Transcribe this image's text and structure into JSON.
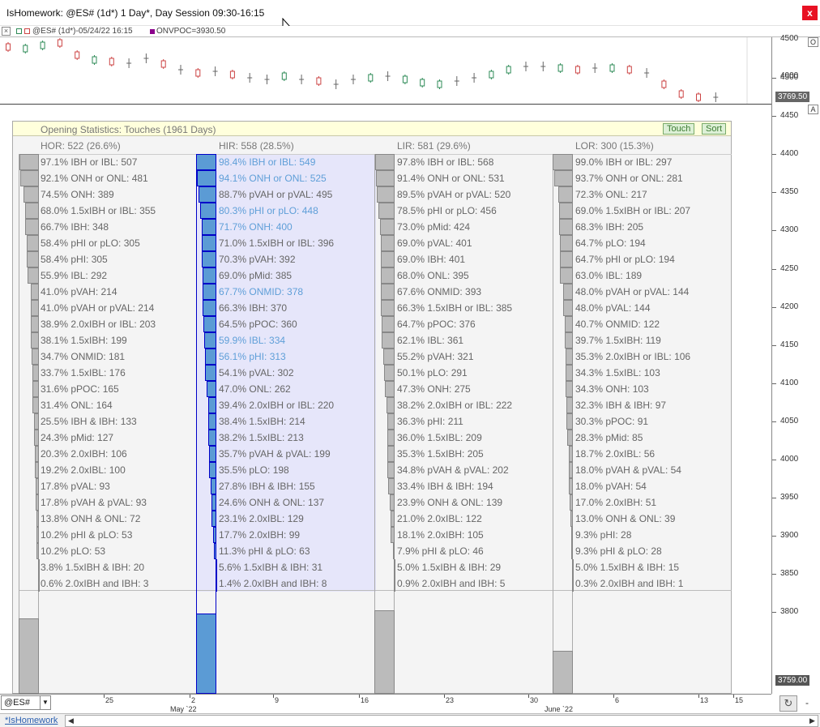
{
  "window": {
    "title": "IsHomework: @ES# (1d*) 1 Day*, Day Session 09:30-16:15",
    "close_label": "x"
  },
  "infobar": {
    "symbol_label": "@ES# (1d*)-05/24/22 16:15",
    "onvpoc_label": "ONVPOC=3930.50"
  },
  "price_axis": {
    "ticks": [
      "4500",
      "4450",
      "4400",
      "4350",
      "4300",
      "4250",
      "4200",
      "4150",
      "4100",
      "4050",
      "4000",
      "3950",
      "3900",
      "3850",
      "3800"
    ],
    "upper_ticks": [
      "4500",
      "4000"
    ],
    "last_price_upper": "3769.50",
    "last_price_lower": "3759.00",
    "btn_o": "O",
    "btn_a": "A"
  },
  "stats": {
    "title": "Opening Statistics: Touches (1961 Days)",
    "touch_label": "Touch",
    "sort_label": "Sort",
    "columns": [
      {
        "header": "HOR: 522 (26.6%)",
        "bottom_fraction": 0.266,
        "rows": [
          {
            "pct": 97.1,
            "text": "97.1%  IBH or IBL: 507"
          },
          {
            "pct": 92.1,
            "text": "92.1%  ONH or ONL: 481"
          },
          {
            "pct": 74.5,
            "text": "74.5%  ONH: 389"
          },
          {
            "pct": 68.0,
            "text": "68.0%  1.5xIBH or IBL: 355"
          },
          {
            "pct": 66.7,
            "text": "66.7%  IBH: 348"
          },
          {
            "pct": 58.4,
            "text": "58.4%  pHI or pLO: 305"
          },
          {
            "pct": 58.4,
            "text": "58.4%  pHI: 305"
          },
          {
            "pct": 55.9,
            "text": "55.9%  IBL: 292"
          },
          {
            "pct": 41.0,
            "text": "41.0%  pVAH: 214"
          },
          {
            "pct": 41.0,
            "text": "41.0%  pVAH or pVAL: 214"
          },
          {
            "pct": 38.9,
            "text": "38.9%  2.0xIBH or IBL: 203"
          },
          {
            "pct": 38.1,
            "text": "38.1%  1.5xIBH: 199"
          },
          {
            "pct": 34.7,
            "text": "34.7%  ONMID: 181"
          },
          {
            "pct": 33.7,
            "text": "33.7%  1.5xIBL: 176"
          },
          {
            "pct": 31.6,
            "text": "31.6%  pPOC: 165"
          },
          {
            "pct": 31.4,
            "text": "31.4%  ONL: 164"
          },
          {
            "pct": 25.5,
            "text": "25.5%  IBH & IBH: 133"
          },
          {
            "pct": 24.3,
            "text": "24.3%  pMid: 127"
          },
          {
            "pct": 20.3,
            "text": "20.3%  2.0xIBH: 106"
          },
          {
            "pct": 19.2,
            "text": "19.2%  2.0xIBL: 100"
          },
          {
            "pct": 17.8,
            "text": "17.8%  pVAL: 93"
          },
          {
            "pct": 17.8,
            "text": "17.8%  pVAH & pVAL: 93"
          },
          {
            "pct": 13.8,
            "text": "13.8%  ONH & ONL: 72"
          },
          {
            "pct": 10.2,
            "text": "10.2%  pHI & pLO: 53"
          },
          {
            "pct": 10.2,
            "text": "10.2%  pLO: 53"
          },
          {
            "pct": 3.8,
            "text": "3.8%  1.5xIBH & IBH: 20"
          },
          {
            "pct": 0.6,
            "text": "0.6%  2.0xIBH and IBH: 3"
          }
        ]
      },
      {
        "header": "HIR: 558 (28.5%)",
        "bottom_fraction": 0.285,
        "rows": [
          {
            "pct": 98.4,
            "text": "98.4%  IBH or IBL: 549",
            "hl": true
          },
          {
            "pct": 94.1,
            "text": "94.1%  ONH or ONL: 525",
            "hl": true
          },
          {
            "pct": 88.7,
            "text": "88.7%  pVAH or pVAL: 495"
          },
          {
            "pct": 80.3,
            "text": "80.3%  pHI or pLO: 448",
            "hl": true
          },
          {
            "pct": 71.7,
            "text": "71.7%  ONH: 400",
            "hl": true
          },
          {
            "pct": 71.0,
            "text": "71.0%  1.5xIBH or IBL: 396"
          },
          {
            "pct": 70.3,
            "text": "70.3%  pVAH: 392"
          },
          {
            "pct": 69.0,
            "text": "69.0%  pMid: 385"
          },
          {
            "pct": 67.7,
            "text": "67.7%  ONMID: 378",
            "hl": true
          },
          {
            "pct": 66.3,
            "text": "66.3%  IBH: 370"
          },
          {
            "pct": 64.5,
            "text": "64.5%  pPOC: 360"
          },
          {
            "pct": 59.9,
            "text": "59.9%  IBL: 334",
            "hl": true
          },
          {
            "pct": 56.1,
            "text": "56.1%  pHI: 313",
            "hl": true
          },
          {
            "pct": 54.1,
            "text": "54.1%  pVAL: 302"
          },
          {
            "pct": 47.0,
            "text": "47.0%  ONL: 262"
          },
          {
            "pct": 39.4,
            "text": "39.4%  2.0xIBH or IBL: 220"
          },
          {
            "pct": 38.4,
            "text": "38.4%  1.5xIBH: 214"
          },
          {
            "pct": 38.2,
            "text": "38.2%  1.5xIBL: 213"
          },
          {
            "pct": 35.7,
            "text": "35.7%  pVAH & pVAL: 199"
          },
          {
            "pct": 35.5,
            "text": "35.5%  pLO: 198"
          },
          {
            "pct": 27.8,
            "text": "27.8%  IBH & IBH: 155"
          },
          {
            "pct": 24.6,
            "text": "24.6%  ONH & ONL: 137"
          },
          {
            "pct": 23.1,
            "text": "23.1%  2.0xIBL: 129"
          },
          {
            "pct": 17.7,
            "text": "17.7%  2.0xIBH: 99"
          },
          {
            "pct": 11.3,
            "text": "11.3%  pHI & pLO: 63"
          },
          {
            "pct": 5.6,
            "text": "5.6%  1.5xIBH & IBH: 31"
          },
          {
            "pct": 1.4,
            "text": "1.4%  2.0xIBH and IBH: 8"
          }
        ]
      },
      {
        "header": "LIR: 581 (29.6%)",
        "bottom_fraction": 0.296,
        "rows": [
          {
            "pct": 97.8,
            "text": "97.8%  IBH or IBL: 568"
          },
          {
            "pct": 91.4,
            "text": "91.4%  ONH or ONL: 531"
          },
          {
            "pct": 89.5,
            "text": "89.5%  pVAH or pVAL: 520"
          },
          {
            "pct": 78.5,
            "text": "78.5%  pHI or pLO: 456"
          },
          {
            "pct": 73.0,
            "text": "73.0%  pMid: 424"
          },
          {
            "pct": 69.0,
            "text": "69.0%  pVAL: 401"
          },
          {
            "pct": 69.0,
            "text": "69.0%  IBH: 401"
          },
          {
            "pct": 68.0,
            "text": "68.0%  ONL: 395"
          },
          {
            "pct": 67.6,
            "text": "67.6%  ONMID: 393"
          },
          {
            "pct": 66.3,
            "text": "66.3%  1.5xIBH or IBL: 385"
          },
          {
            "pct": 64.7,
            "text": "64.7%  pPOC: 376"
          },
          {
            "pct": 62.1,
            "text": "62.1%  IBL: 361"
          },
          {
            "pct": 55.2,
            "text": "55.2%  pVAH: 321"
          },
          {
            "pct": 50.1,
            "text": "50.1%  pLO: 291"
          },
          {
            "pct": 47.3,
            "text": "47.3%  ONH: 275"
          },
          {
            "pct": 38.2,
            "text": "38.2%  2.0xIBH or IBL: 222"
          },
          {
            "pct": 36.3,
            "text": "36.3%  pHI: 211"
          },
          {
            "pct": 36.0,
            "text": "36.0%  1.5xIBL: 209"
          },
          {
            "pct": 35.3,
            "text": "35.3%  1.5xIBH: 205"
          },
          {
            "pct": 34.8,
            "text": "34.8%  pVAH & pVAL: 202"
          },
          {
            "pct": 33.4,
            "text": "33.4%  IBH & IBH: 194"
          },
          {
            "pct": 23.9,
            "text": "23.9%  ONH & ONL: 139"
          },
          {
            "pct": 21.0,
            "text": "21.0%  2.0xIBL: 122"
          },
          {
            "pct": 18.1,
            "text": "18.1%  2.0xIBH: 105"
          },
          {
            "pct": 7.9,
            "text": "7.9%  pHI & pLO: 46"
          },
          {
            "pct": 5.0,
            "text": "5.0%  1.5xIBH & IBH: 29"
          },
          {
            "pct": 0.9,
            "text": "0.9%  2.0xIBH and IBH: 5"
          }
        ]
      },
      {
        "header": "LOR: 300 (15.3%)",
        "bottom_fraction": 0.153,
        "rows": [
          {
            "pct": 99.0,
            "text": "99.0%  IBH or IBL: 297"
          },
          {
            "pct": 93.7,
            "text": "93.7%  ONH or ONL: 281"
          },
          {
            "pct": 72.3,
            "text": "72.3%  ONL: 217"
          },
          {
            "pct": 69.0,
            "text": "69.0%  1.5xIBH or IBL: 207"
          },
          {
            "pct": 68.3,
            "text": "68.3%  IBH: 205"
          },
          {
            "pct": 64.7,
            "text": "64.7%  pLO: 194"
          },
          {
            "pct": 64.7,
            "text": "64.7%  pHI or pLO: 194"
          },
          {
            "pct": 63.0,
            "text": "63.0%  IBL: 189"
          },
          {
            "pct": 48.0,
            "text": "48.0%  pVAH or pVAL: 144"
          },
          {
            "pct": 48.0,
            "text": "48.0%  pVAL: 144"
          },
          {
            "pct": 40.7,
            "text": "40.7%  ONMID: 122"
          },
          {
            "pct": 39.7,
            "text": "39.7%  1.5xIBH: 119"
          },
          {
            "pct": 35.3,
            "text": "35.3%  2.0xIBH or IBL: 106"
          },
          {
            "pct": 34.3,
            "text": "34.3%  1.5xIBL: 103"
          },
          {
            "pct": 34.3,
            "text": "34.3%  ONH: 103"
          },
          {
            "pct": 32.3,
            "text": "32.3%  IBH & IBH: 97"
          },
          {
            "pct": 30.3,
            "text": "30.3%  pPOC: 91"
          },
          {
            "pct": 28.3,
            "text": "28.3%  pMid: 85"
          },
          {
            "pct": 18.7,
            "text": "18.7%  2.0xIBL: 56"
          },
          {
            "pct": 18.0,
            "text": "18.0%  pVAH & pVAL: 54"
          },
          {
            "pct": 18.0,
            "text": "18.0%  pVAH: 54"
          },
          {
            "pct": 17.0,
            "text": "17.0%  2.0xIBH: 51"
          },
          {
            "pct": 13.0,
            "text": "13.0%  ONH & ONL: 39"
          },
          {
            "pct": 9.3,
            "text": "9.3%  pHI: 28"
          },
          {
            "pct": 9.3,
            "text": "9.3%  pHI & pLO: 28"
          },
          {
            "pct": 5.0,
            "text": "5.0%  1.5xIBH & IBH: 15"
          },
          {
            "pct": 0.3,
            "text": "0.3%  2.0xIBH and IBH: 1"
          }
        ]
      }
    ]
  },
  "date_axis": {
    "days": [
      "25",
      "2",
      "9",
      "16",
      "23",
      "30",
      "6",
      "13",
      "15"
    ],
    "months": [
      "May `22",
      "June `22"
    ]
  },
  "bottom": {
    "symbol": "@ES#",
    "tab_label": "*IsHomework",
    "refresh_icon": "↻",
    "minus_label": "-"
  },
  "colors": {
    "highlight_text": "#5f9fd8",
    "hir_bar": "#5b9bd5",
    "hir_background": "#e6e6fa",
    "header_background": "#ffffdc",
    "touch_sort_btn": "#ddf0d6"
  }
}
